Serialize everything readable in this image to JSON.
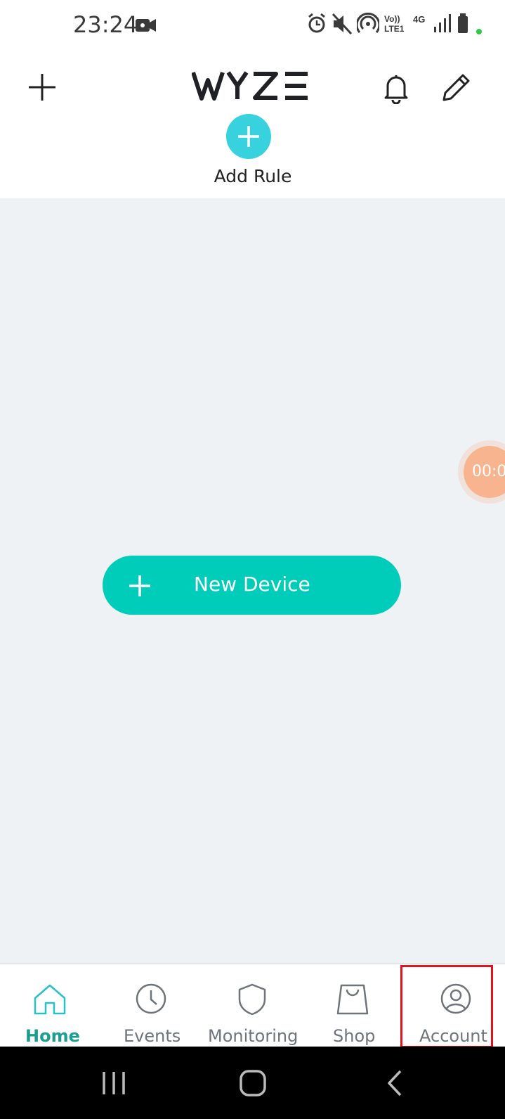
{
  "status_bar": {
    "time": "23:24",
    "icons": [
      "video-recording-icon",
      "alarm-icon",
      "mute-icon",
      "hotspot-icon",
      "volte-icon",
      "4g-icon",
      "signal-icon",
      "battery-icon"
    ],
    "volte_text": "Vo)) LTE1",
    "network_text": "4G"
  },
  "header": {
    "logo_text": "WYZE",
    "add_rule_label": "Add Rule"
  },
  "main": {
    "new_device_label": "New Device",
    "timer_text": "00:0"
  },
  "bottom_nav": {
    "items": [
      {
        "label": "Home",
        "icon": "home-icon",
        "active": true
      },
      {
        "label": "Events",
        "icon": "clock-icon",
        "active": false
      },
      {
        "label": "Monitoring",
        "icon": "shield-icon",
        "active": false
      },
      {
        "label": "Shop",
        "icon": "shopping-bag-icon",
        "active": false
      },
      {
        "label": "Account",
        "icon": "account-icon",
        "active": false
      }
    ]
  },
  "colors": {
    "accent": "#00cdb9",
    "add_rule": "#38d2de",
    "active_tab": "#1a9e8f",
    "highlight": "#e0141e",
    "background": "#eef2f5"
  }
}
